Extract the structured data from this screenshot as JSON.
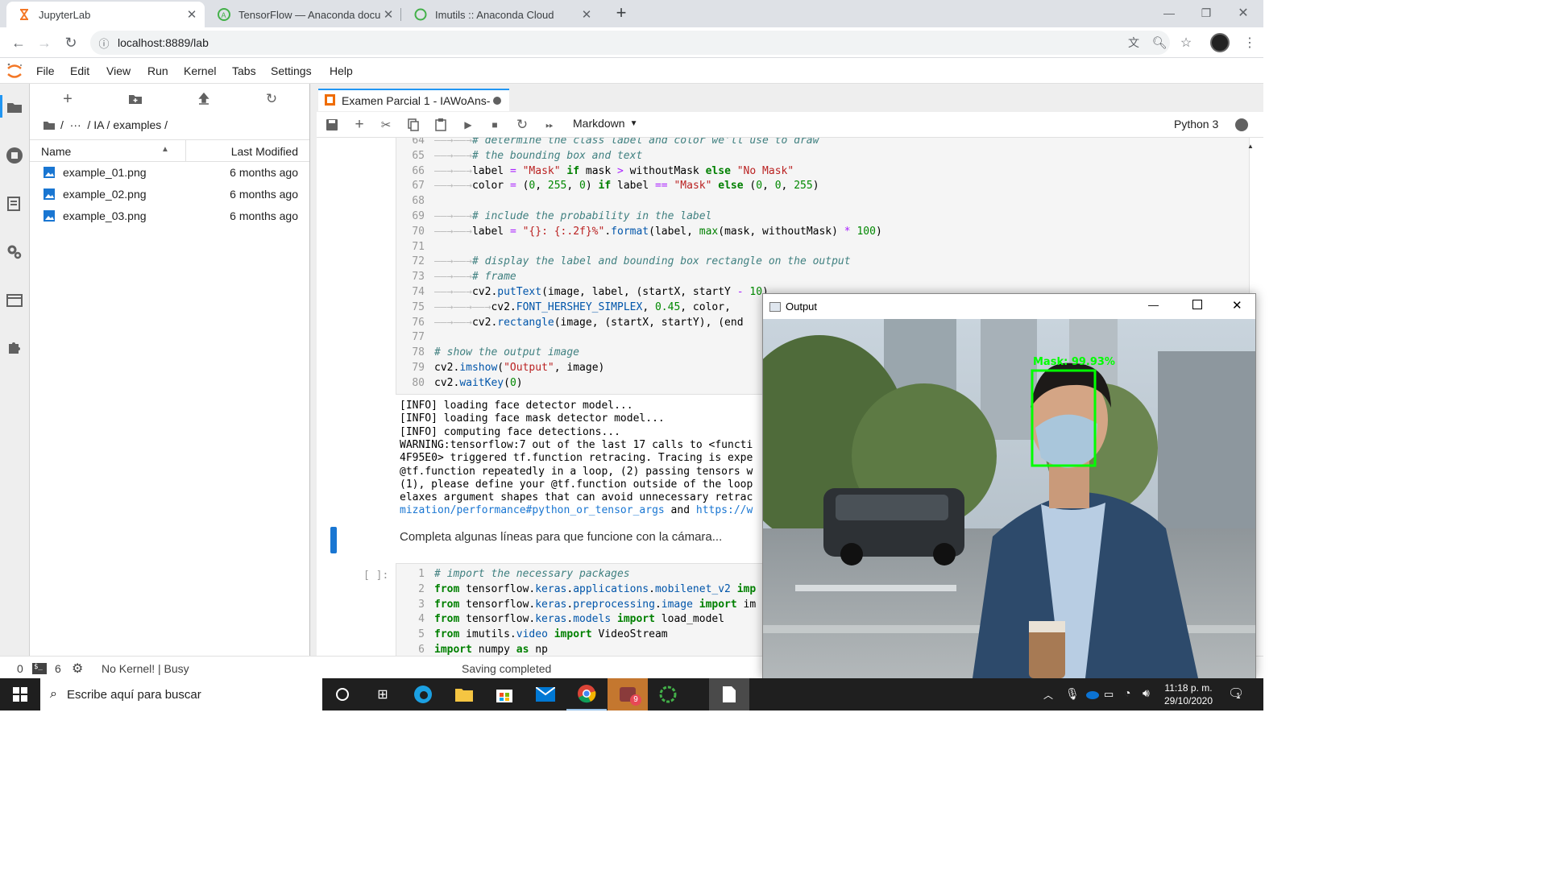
{
  "browser": {
    "tabs": [
      {
        "title": "JupyterLab",
        "active": true
      },
      {
        "title": "TensorFlow — Anaconda docume",
        "active": false
      },
      {
        "title": "Imutils :: Anaconda Cloud",
        "active": false
      }
    ],
    "url": "localhost:8889/lab"
  },
  "menu": [
    "File",
    "Edit",
    "View",
    "Run",
    "Kernel",
    "Tabs",
    "Settings",
    "Help"
  ],
  "filebrowser": {
    "breadcrumb": "/  ···  / IA / examples /",
    "col_name": "Name",
    "col_modified": "Last Modified",
    "files": [
      {
        "name": "example_01.png",
        "modified": "6 months ago"
      },
      {
        "name": "example_02.png",
        "modified": "6 months ago"
      },
      {
        "name": "example_03.png",
        "modified": "6 months ago"
      }
    ]
  },
  "notebook": {
    "tab_title": "Examen Parcial 1 - IAWoAns-",
    "cell_type": "Markdown",
    "kernel": "Python 3",
    "code1_lines": [
      {
        "n": "64",
        "html": "<span class='tab'>——→——→</span><span class='cm'># determine the class label and color we'll use to draw</span>"
      },
      {
        "n": "65",
        "html": "<span class='tab'>——→——→</span><span class='cm'># the bounding box and text</span>"
      },
      {
        "n": "66",
        "html": "<span class='tab'>——→——→</span>label <span class='op'>=</span> <span class='st'>\"Mask\"</span> <span class='kw'>if</span> mask <span class='op'>&gt;</span> withoutMask <span class='kw'>else</span> <span class='st'>\"No Mask\"</span>"
      },
      {
        "n": "67",
        "html": "<span class='tab'>——→——→</span>color <span class='op'>=</span> (<span class='nu'>0</span>, <span class='nu'>255</span>, <span class='nu'>0</span>) <span class='kw'>if</span> label <span class='op'>==</span> <span class='st'>\"Mask\"</span> <span class='kw'>else</span> (<span class='nu'>0</span>, <span class='nu'>0</span>, <span class='nu'>255</span>)"
      },
      {
        "n": "68",
        "html": ""
      },
      {
        "n": "69",
        "html": "<span class='tab'>——→——→</span><span class='cm'># include the probability in the label</span>"
      },
      {
        "n": "70",
        "html": "<span class='tab'>——→——→</span>label <span class='op'>=</span> <span class='st'>\"{}: {:.2f}%\"</span>.<span class='fn'>format</span>(label, <span class='kw' style='font-weight:normal;color:#008000'>max</span>(mask, withoutMask) <span class='op'>*</span> <span class='nu'>100</span>)"
      },
      {
        "n": "71",
        "html": ""
      },
      {
        "n": "72",
        "html": "<span class='tab'>——→——→</span><span class='cm'># display the label and bounding box rectangle on the output</span>"
      },
      {
        "n": "73",
        "html": "<span class='tab'>——→——→</span><span class='cm'># frame</span>"
      },
      {
        "n": "74",
        "html": "<span class='tab'>——→——→</span>cv2.<span class='fn'>putText</span>(image, label, (startX, startY <span class='op'>-</span> <span class='nu'>10</span>),"
      },
      {
        "n": "75",
        "html": "<span class='tab'>——→——→——→</span>cv2.<span class='fn'>FONT_HERSHEY_SIMPLEX</span>, <span class='nu'>0.45</span>, color,"
      },
      {
        "n": "76",
        "html": "<span class='tab'>——→——→</span>cv2.<span class='fn'>rectangle</span>(image, (startX, startY), (end"
      },
      {
        "n": "77",
        "html": ""
      },
      {
        "n": "78",
        "html": "<span class='cm'># show the output image</span>"
      },
      {
        "n": "79",
        "html": "cv2.<span class='fn'>imshow</span>(<span class='st'>\"Output\"</span>, image)"
      },
      {
        "n": "80",
        "html": "cv2.<span class='fn'>waitKey</span>(<span class='nu'>0</span>)"
      }
    ],
    "output_lines": [
      "[INFO] loading face detector model...",
      "[INFO] loading face mask detector model...",
      "[INFO] computing face detections...",
      "WARNING:tensorflow:7 out of the last 17 calls to <functi",
      "4F95E0> triggered tf.function retracing. Tracing is expe",
      "@tf.function repeatedly in a loop, (2) passing tensors w",
      "(1), please define your @tf.function outside of the loop",
      "elaxes argument shapes that can avoid unnecessary retrac"
    ],
    "output_link_line": {
      "a": "mization/performance#python_or_tensor_args",
      "mid": " and ",
      "b": "https://w"
    },
    "markdown_text": "Completa algunas líneas para que funcione con la cámara...",
    "prompt2": "[ ]:",
    "code2_lines": [
      {
        "n": "1",
        "html": "<span class='cm'># import the necessary packages</span>"
      },
      {
        "n": "2",
        "html": "<span class='kw'>from</span> tensorflow.<span class='fn'>keras</span>.<span class='fn'>applications</span>.<span class='fn'>mobilenet_v2</span> <span class='kw'>imp</span>"
      },
      {
        "n": "3",
        "html": "<span class='kw'>from</span> tensorflow.<span class='fn'>keras</span>.<span class='fn'>preprocessing</span>.<span class='fn'>image</span> <span class='kw'>import</span> im"
      },
      {
        "n": "4",
        "html": "<span class='kw'>from</span> tensorflow.<span class='fn'>keras</span>.<span class='fn'>models</span> <span class='kw'>import</span> load_model"
      },
      {
        "n": "5",
        "html": "<span class='kw'>from</span> imutils.<span class='fn'>video</span> <span class='kw'>import</span> VideoStream"
      },
      {
        "n": "6",
        "html": "<span class='kw'>import</span> numpy <span class='kw'>as</span> np"
      }
    ]
  },
  "status": {
    "num0": "0",
    "num1": "6",
    "kernel": "No Kernel! | Busy",
    "saving": "Saving completed"
  },
  "output_window": {
    "title": "Output",
    "label": "Mask: 99.93%"
  },
  "taskbar": {
    "search": "Escribe aquí para buscar",
    "time": "11:18 p. m.",
    "date": "29/10/2020",
    "badge": "1",
    "app_badge": "9"
  }
}
